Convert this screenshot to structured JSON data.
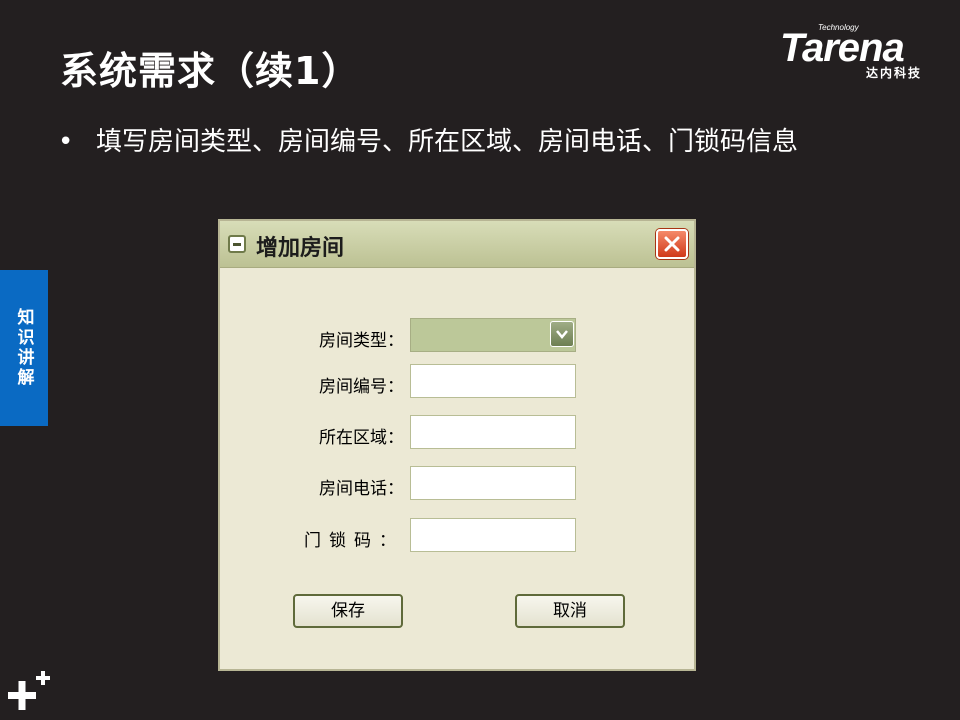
{
  "slide": {
    "title": "系统需求（续1）",
    "bullet": "填写房间类型、房间编号、所在区域、房间电话、门锁码信息",
    "side_tab": "知识讲解"
  },
  "logo": {
    "word": "Tarena",
    "tagline": "Technology",
    "chinese": "达内科技"
  },
  "dialog": {
    "title": "增加房间",
    "fields": [
      {
        "label": "房间类型：",
        "type": "select",
        "value": ""
      },
      {
        "label": "房间编号：",
        "type": "text",
        "value": ""
      },
      {
        "label": "所在区域：",
        "type": "text",
        "value": ""
      },
      {
        "label": "房间电话：",
        "type": "text",
        "value": ""
      },
      {
        "label": "门锁码：",
        "type": "text",
        "value": ""
      }
    ],
    "buttons": {
      "save": "保存",
      "cancel": "取消"
    }
  },
  "icons": {
    "bullet": "bullet-dot",
    "system_menu": "window-menu-icon",
    "close": "close-x-icon",
    "dropdown": "chevron-down-icon",
    "corner": "plus-plus-icon"
  },
  "colors": {
    "slide_background": "#231f20",
    "side_tab": "#0a6ac3",
    "dialog_background": "#ece9d5",
    "close_button": "#d0391a",
    "combo_fill": "#bcc899"
  }
}
